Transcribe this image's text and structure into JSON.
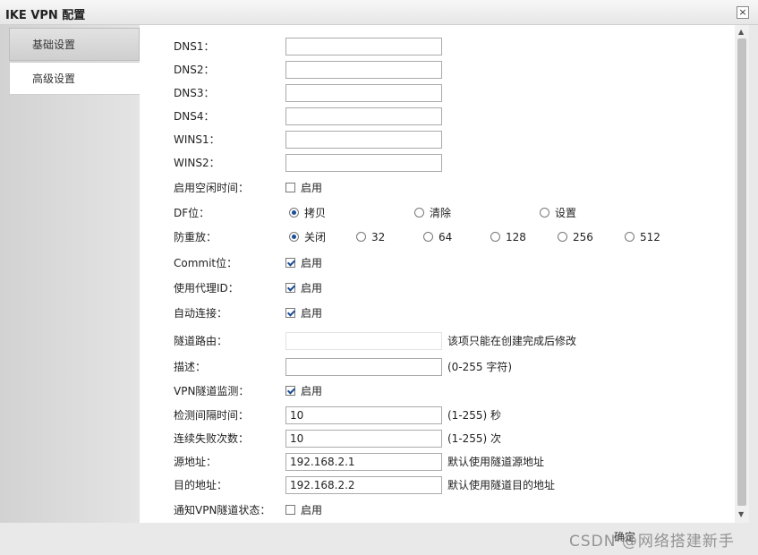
{
  "window": {
    "title": "IKE VPN 配置",
    "close_glyph": "×"
  },
  "tabs": {
    "basic": "基础设置",
    "advanced": "高级设置"
  },
  "fields": {
    "dns1_label": "DNS1：",
    "dns2_label": "DNS2：",
    "dns3_label": "DNS3：",
    "dns4_label": "DNS4：",
    "wins1_label": "WINS1：",
    "wins2_label": "WINS2：",
    "idle_time_label": "启用空闲时间：",
    "idle_time_option": "启用",
    "df_label": "DF位：",
    "df_options": [
      "拷贝",
      "清除",
      "设置"
    ],
    "replay_label": "防重放：",
    "replay_options": [
      "关闭",
      "32",
      "64",
      "128",
      "256",
      "512"
    ],
    "commit_label": "Commit位：",
    "commit_option": "启用",
    "proxy_id_label": "使用代理ID：",
    "proxy_id_option": "启用",
    "auto_connect_label": "自动连接：",
    "auto_connect_option": "启用",
    "tunnel_route_label": "隧道路由：",
    "tunnel_route_hint": "该项只能在创建完成后修改",
    "description_label": "描述：",
    "description_hint": "(0-255 字符)",
    "vpn_monitor_label": "VPN隧道监测：",
    "vpn_monitor_option": "启用",
    "interval_label": "检测间隔时间：",
    "interval_value": "10",
    "interval_hint": "(1-255) 秒",
    "failures_label": "连续失败次数：",
    "failures_value": "10",
    "failures_hint": "(1-255) 次",
    "source_label": "源地址：",
    "source_value": "192.168.2.1",
    "source_hint": "默认使用隧道源地址",
    "dest_label": "目的地址：",
    "dest_value": "192.168.2.2",
    "dest_hint": "默认使用隧道目的地址",
    "notify_label": "通知VPN隧道状态：",
    "notify_option": "启用"
  },
  "footer": {
    "ok_label": "确定",
    "watermark": "CSDN @网络搭建新手"
  }
}
